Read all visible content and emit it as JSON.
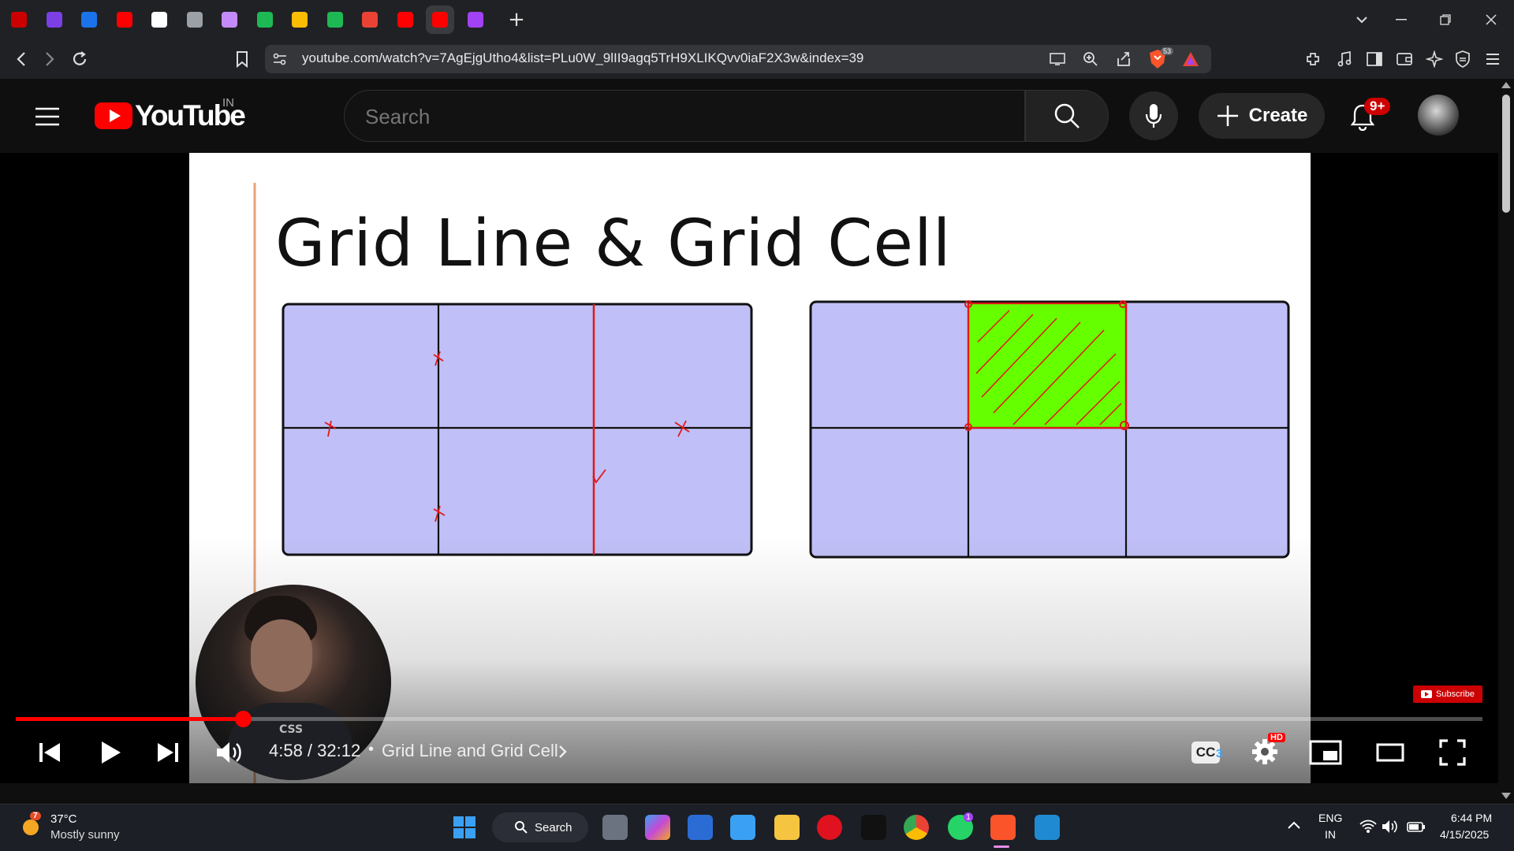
{
  "browser": {
    "tabs": [
      {
        "icon": "youtube-red-line-icon",
        "color": "#c00"
      },
      {
        "icon": "m-letter-icon",
        "color": "#7b3fe4"
      },
      {
        "icon": "s-letter-icon",
        "color": "#1a73e8"
      },
      {
        "icon": "youtube-icon",
        "color": "#ff0000"
      },
      {
        "icon": "github-icon",
        "color": "#ffffff"
      },
      {
        "icon": "globe-icon",
        "color": "#9aa0a6"
      },
      {
        "icon": "avatar-icon",
        "color": "#c58af9"
      },
      {
        "icon": "green-circle-icon",
        "color": "#1db954"
      },
      {
        "icon": "yellow-note-icon",
        "color": "#fbbc04"
      },
      {
        "icon": "spotify-icon",
        "color": "#1db954"
      },
      {
        "icon": "gmail-icon",
        "color": "#ea4335"
      },
      {
        "icon": "youtube-icon",
        "color": "#ff0000"
      },
      {
        "icon": "youtube-icon",
        "color": "#ff0000",
        "active": true
      },
      {
        "icon": "star-app-icon",
        "color": "#a142f4"
      }
    ],
    "new_tab_label": "+",
    "url": "youtube.com/watch?v=7AgEjgUtho4&list=PLu0W_9lII9agq5TrH9XLIKQvv0iaF2X3w&index=39",
    "brave_shield_count": "53"
  },
  "youtube": {
    "logo_text": "YouTube",
    "country": "IN",
    "search_placeholder": "Search",
    "create_label": "Create",
    "notification_badge": "9+"
  },
  "video": {
    "slide_title": "Grid Line & Grid Cell",
    "progress_fraction": 0.155,
    "time": "4:58 / 32:12",
    "separator": "•",
    "chapter": "Grid Line and Grid Cell",
    "cc_count": "3",
    "hd_badge": "HD",
    "subscribe_label": "Subscribe",
    "grid_fill": "#c0bff7",
    "highlight_fill": "#66ff00",
    "marker_color": "#e01818"
  },
  "taskbar": {
    "weather_badge": "7",
    "temperature": "37°C",
    "weather_desc": "Mostly sunny",
    "search_label": "Search",
    "whatsapp_badge": "1",
    "lang": "ENG",
    "region": "IN",
    "time": "6:44 PM",
    "date": "4/15/2025"
  }
}
